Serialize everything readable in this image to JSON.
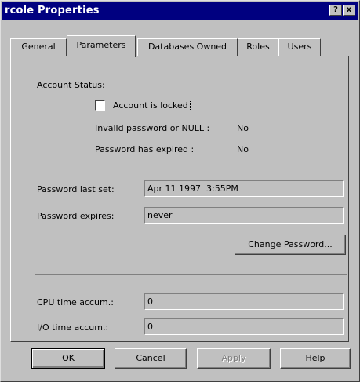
{
  "window": {
    "title": "rcole Properties",
    "help_label": "?",
    "close_label": "x"
  },
  "tabs": [
    {
      "label": "General",
      "active": false
    },
    {
      "label": "Parameters",
      "active": true
    },
    {
      "label": "Databases Owned",
      "active": false
    },
    {
      "label": "Roles",
      "active": false
    },
    {
      "label": "Users",
      "active": false
    }
  ],
  "account_status": {
    "heading": "Account Status:",
    "locked_label": "Account is locked",
    "locked_checked": false,
    "invalid_password_label": "Invalid password or NULL :",
    "invalid_password_value": "No",
    "password_expired_label": "Password has expired :",
    "password_expired_value": "No"
  },
  "password": {
    "last_set_label": "Password last set:",
    "last_set_value": "Apr 11 1997  3:55PM",
    "expires_label": "Password expires:",
    "expires_value": "never",
    "change_button": "Change Password..."
  },
  "usage": {
    "cpu_label": "CPU time accum.:",
    "cpu_value": "0",
    "io_label": "I/O time accum.:",
    "io_value": "0"
  },
  "buttons": {
    "ok": "OK",
    "cancel": "Cancel",
    "apply": "Apply",
    "help": "Help"
  }
}
